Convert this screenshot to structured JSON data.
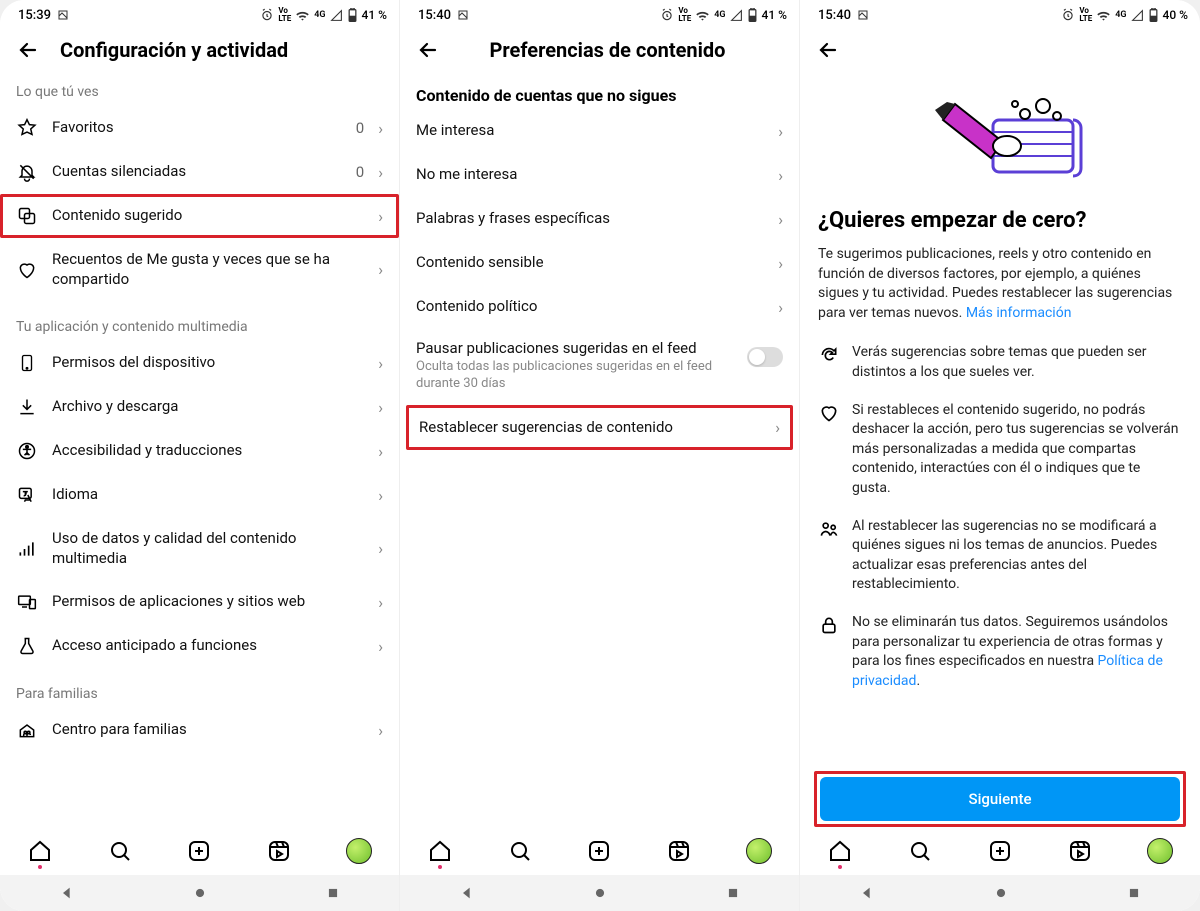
{
  "screens": [
    {
      "status": {
        "time": "15:39",
        "battery": "41 %"
      },
      "header": {
        "title": "Configuración y actividad"
      },
      "section1_label": "Lo que tú ves",
      "rows1": [
        {
          "label": "Favoritos",
          "value": "0"
        },
        {
          "label": "Cuentas silenciadas",
          "value": "0"
        },
        {
          "label": "Contenido sugerido"
        },
        {
          "label": "Recuentos de Me gusta y veces que se ha compartido"
        }
      ],
      "section2_label": "Tu aplicación y contenido multimedia",
      "rows2": [
        {
          "label": "Permisos del dispositivo"
        },
        {
          "label": "Archivo y descarga"
        },
        {
          "label": "Accesibilidad y traducciones"
        },
        {
          "label": "Idioma"
        },
        {
          "label": "Uso de datos y calidad del contenido multimedia"
        },
        {
          "label": "Permisos de aplicaciones y sitios web"
        },
        {
          "label": "Acceso anticipado a funciones"
        }
      ],
      "section3_label": "Para familias",
      "rows3": [
        {
          "label": "Centro para familias"
        }
      ]
    },
    {
      "status": {
        "time": "15:40",
        "battery": "41 %"
      },
      "header": {
        "title": "Preferencias de contenido"
      },
      "section_title": "Contenido de cuentas que no sigues",
      "rows": [
        {
          "label": "Me interesa"
        },
        {
          "label": "No me interesa"
        },
        {
          "label": "Palabras y frases específicas"
        },
        {
          "label": "Contenido sensible"
        },
        {
          "label": "Contenido político"
        }
      ],
      "pause": {
        "title": "Pausar publicaciones sugeridas en el feed",
        "sub": "Oculta todas las publicaciones sugeridas en el feed durante 30 días"
      },
      "reset_row": {
        "label": "Restablecer sugerencias de contenido"
      }
    },
    {
      "status": {
        "time": "15:40",
        "battery": "40 %"
      },
      "title": "¿Quieres empezar de cero?",
      "desc": "Te sugerimos publicaciones, reels y otro contenido en función de diversos factores, por ejemplo, a quiénes sigues y tu actividad. Puedes restablecer las sugerencias para ver temas nuevos. ",
      "desc_link": "Más información",
      "bullets": [
        "Verás sugerencias sobre temas que pueden ser distintos a los que sueles ver.",
        "Si restableces el contenido sugerido, no podrás deshacer la acción, pero tus sugerencias se volverán más personalizadas a medida que compartas contenido, interactúes con él o indiques que te gusta.",
        "Al restablecer las sugerencias no se modificará a quiénes sigues ni los temas de anuncios. Puedes actualizar esas preferencias antes del restablecimiento."
      ],
      "bullet4_pre": "No se eliminarán tus datos. Seguiremos usándolos para personalizar tu experiencia de otras formas y para los fines especificados en nuestra ",
      "bullet4_link": "Política de privacidad",
      "bullet4_post": ".",
      "button": "Siguiente"
    }
  ],
  "status_icons": {
    "net": "Vo LTE",
    "sig": "4G"
  }
}
